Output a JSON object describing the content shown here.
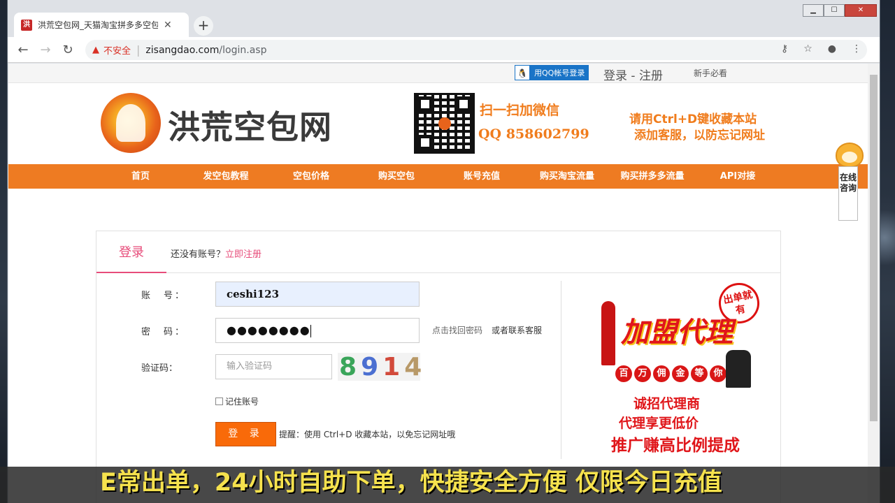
{
  "browser": {
    "tab_title": "洪荒空包网_天猫淘宝拼多多空包",
    "tab_favicon": "洪",
    "insecure_label": "不安全",
    "url_domain": "zisangdao.com",
    "url_path": "/login.asp"
  },
  "topbar": {
    "qq_login": "用QQ帐号登录",
    "login_register": "登录 - 注册",
    "newbie": "新手必看"
  },
  "header": {
    "site_name": "洪荒空包网",
    "scan_text": "扫一扫加微信",
    "qq_text": "QQ 858602799",
    "bookmark_line1": "请用Ctrl+D键收藏本站",
    "bookmark_line2": "添加客服，以防忘记网址"
  },
  "nav": {
    "items": [
      "首页",
      "发空包教程",
      "空包价格",
      "购买空包",
      "账号充值",
      "购买淘宝流量",
      "购买拼多多流量",
      "API对接"
    ]
  },
  "consult": {
    "label": "在线咨询"
  },
  "login": {
    "tab": "登录",
    "no_account": "还没有账号？",
    "register_link": "立即注册",
    "account_label": "账　号：",
    "account_value": "ceshi123",
    "password_label": "密　码：",
    "password_mask": "●●●●●●●●",
    "captcha_label": "验证码：",
    "captcha_placeholder": "输入验证码",
    "captcha_digits": [
      "8",
      "9",
      "1",
      "4"
    ],
    "forgot": "点击找回密码",
    "contact": "或者联系客服",
    "remember": "记住账号",
    "submit": "登 录",
    "tip": "提醒：使用 Ctrl+D 收藏本站，以免忘记网址哦"
  },
  "promo": {
    "stamp": "出单就有",
    "headline": "加盟代理",
    "bubbles": [
      "百",
      "万",
      "佣",
      "金",
      "等",
      "你"
    ],
    "line1": "诚招代理商",
    "line2": "代理享更低价",
    "line3": "推广赚高比例提成"
  },
  "subtitle": "E常出单，24小时自助下单，快捷安全方便 仅限今日充值"
}
